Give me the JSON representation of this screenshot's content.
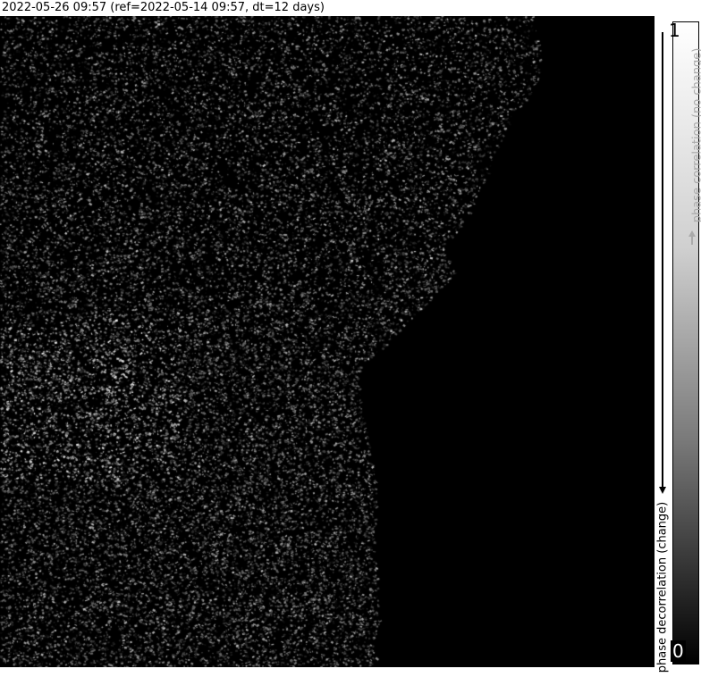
{
  "header": {
    "title": "2022-05-26 09:57 (ref=2022-05-14 09:57, dt=12 days)"
  },
  "colorbar": {
    "max_label": "1",
    "min_label": "0",
    "top_label": "phase correlation (no change)",
    "bottom_label": "phase decorrelation (change)",
    "top_color": "#ffffff",
    "bottom_color": "#000000",
    "top_label_color": "#aaaaaa"
  },
  "map": {
    "nodata_color": "#000000"
  }
}
